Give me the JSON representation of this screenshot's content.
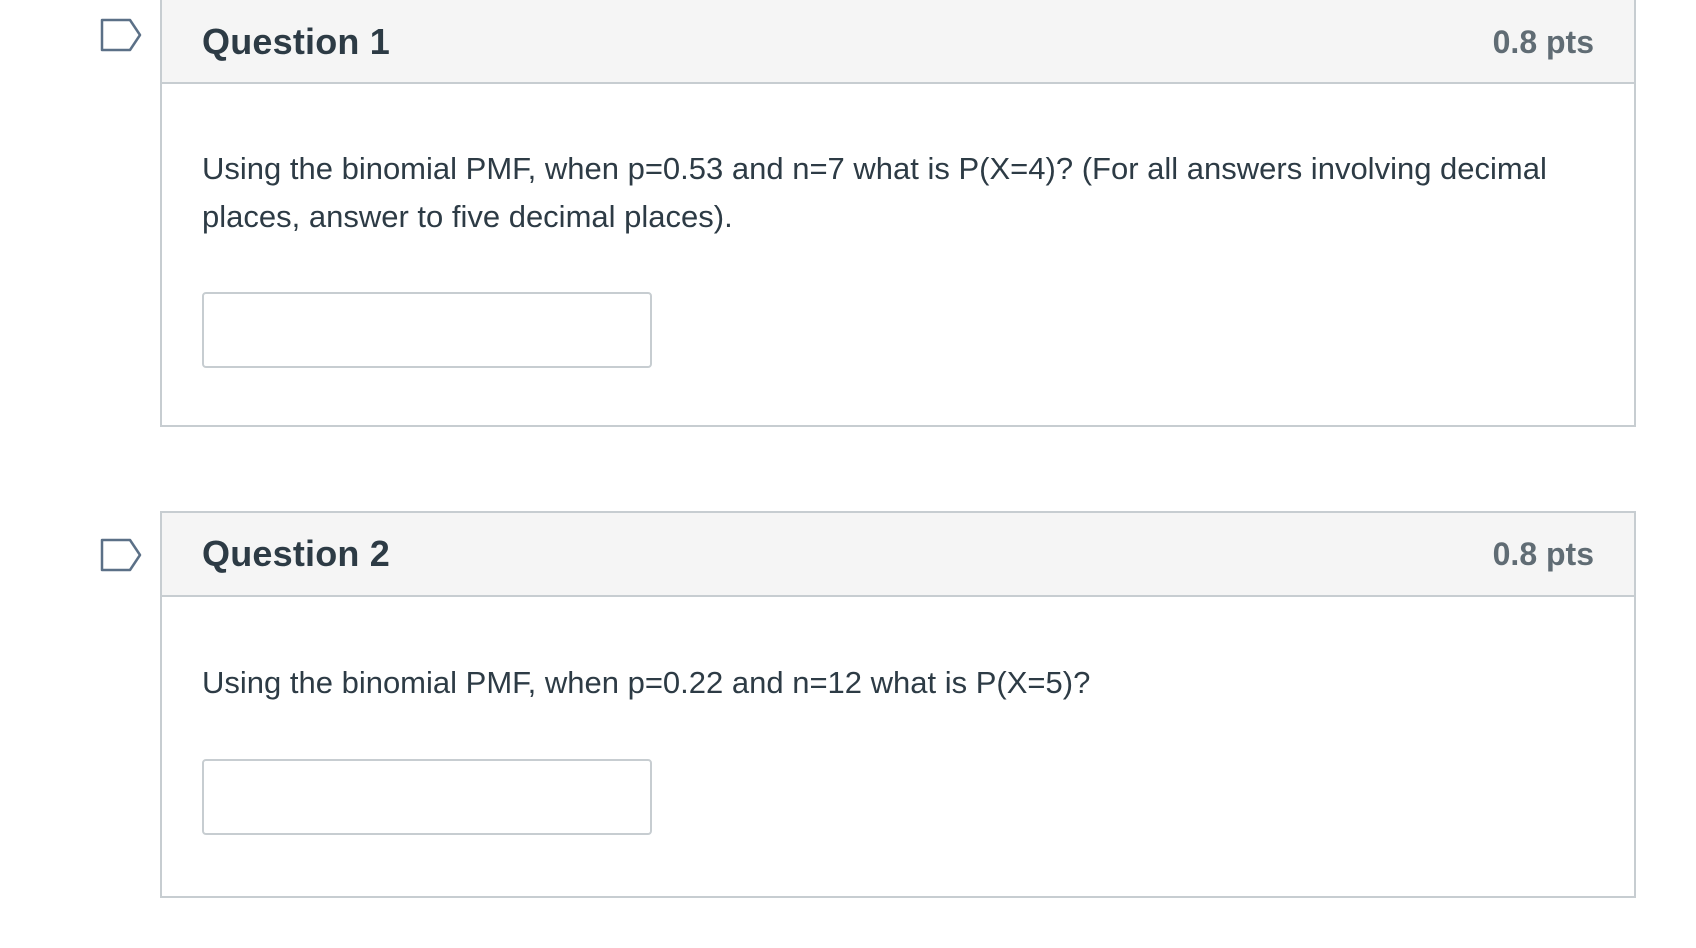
{
  "questions": [
    {
      "title": "Question 1",
      "points": "0.8 pts",
      "text": "Using the binomial PMF, when p=0.53 and n=7 what is P(X=4)? (For all answers involving decimal places, answer to five decimal places).",
      "answer_value": "",
      "flag_icon": "flag-question-icon"
    },
    {
      "title": "Question 2",
      "points": "0.8 pts",
      "text": "Using the binomial PMF, when p=0.22 and n=12 what is P(X=5)?",
      "answer_value": "",
      "flag_icon": "flag-question-icon"
    }
  ],
  "colors": {
    "header_bg": "#f5f5f5",
    "border": "#c7cdd1",
    "text": "#2d3b45",
    "points": "#606c74",
    "flag_stroke": "#5b7087"
  }
}
